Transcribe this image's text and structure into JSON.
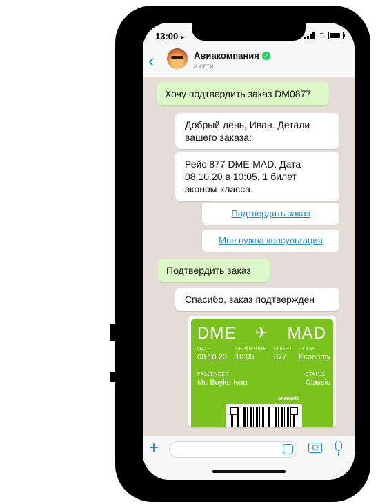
{
  "status_bar": {
    "time": "13:00"
  },
  "header": {
    "contact_name": "Авиакомпания",
    "contact_status": "в сети"
  },
  "messages": [
    {
      "from": "user",
      "text": "Хочу подтвердить заказ DM0877"
    },
    {
      "from": "bot",
      "text": "Добрый день, Иван. Детали вашего заказа:"
    },
    {
      "from": "bot",
      "text": "Рейс 877 DME-MAD. Дата 08.10.20 в 10:05. 1 билет эконом-класса."
    },
    {
      "from": "user",
      "text": "Подтвердить заказ"
    },
    {
      "from": "bot",
      "text": "Спасибо, заказ подтвержден"
    }
  ],
  "quick_replies": [
    "Подтвердить заказ",
    "Мне нужна консультация"
  ],
  "ticket": {
    "from": "DME",
    "to": "MAD",
    "date_label": "DATE",
    "date": "08.10.20",
    "departure_label": "DEPARTURE",
    "departure": "10:05",
    "flight_label": "FLIGHT",
    "flight": "877",
    "class_label": "CLASS",
    "class": "Economy",
    "passenger_label": "PASSENGER",
    "passenger": "Mr. Boyko Ivan",
    "status_label": "STATUS",
    "status": "Classic",
    "alliance": "oneworld"
  },
  "input": {
    "placeholder": ""
  },
  "colors": {
    "accent": "#1a8ad4",
    "outgoing_bubble": "#dcf8c6",
    "incoming_bubble": "#ffffff",
    "chat_background": "#e5ddd5",
    "ticket_green": "#7ac21d",
    "verified": "#25d366"
  },
  "icons": [
    "back-icon",
    "verified-icon",
    "airplane-icon",
    "plus-icon",
    "sticker-icon",
    "camera-icon",
    "mic-icon",
    "wifi-icon",
    "signal-icon",
    "battery-icon",
    "location-arrow-icon"
  ]
}
